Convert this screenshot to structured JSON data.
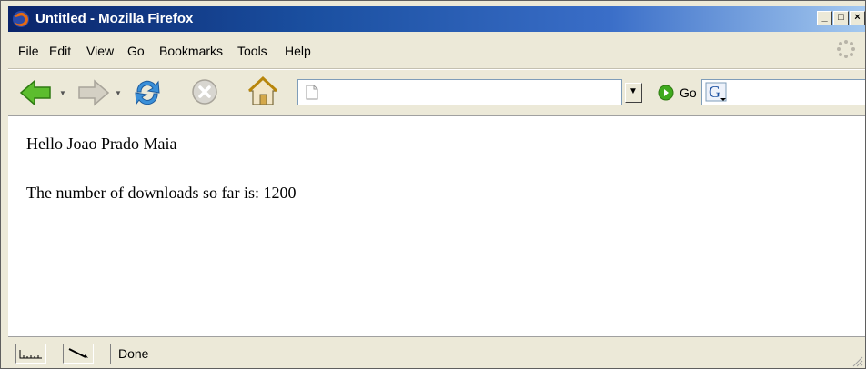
{
  "window": {
    "title": "Untitled - Mozilla Firefox",
    "controls": [
      "minimize",
      "maximize",
      "close"
    ]
  },
  "menubar": {
    "items": [
      {
        "label": "File"
      },
      {
        "label": "Edit"
      },
      {
        "label": "View"
      },
      {
        "label": "Go"
      },
      {
        "label": "Bookmarks"
      },
      {
        "label": "Tools"
      },
      {
        "label": "Help"
      }
    ]
  },
  "navbar": {
    "buttons": [
      "back-icon",
      "forward-icon",
      "reload-icon",
      "stop-icon",
      "home-icon"
    ],
    "address": {
      "value": "",
      "placeholder": ""
    },
    "go_label": "Go",
    "search": {
      "value": "",
      "engine_icon": "google-icon"
    }
  },
  "content": {
    "lines": [
      "Hello Joao Prado Maia",
      "The number of downloads so far is: 1200"
    ]
  },
  "statusbar": {
    "text": "Done"
  },
  "colors": {
    "title_start": "#0a246a",
    "title_end": "#a6caf0",
    "chrome": "#ece9d8",
    "arrow_green": "#3faa1e"
  }
}
